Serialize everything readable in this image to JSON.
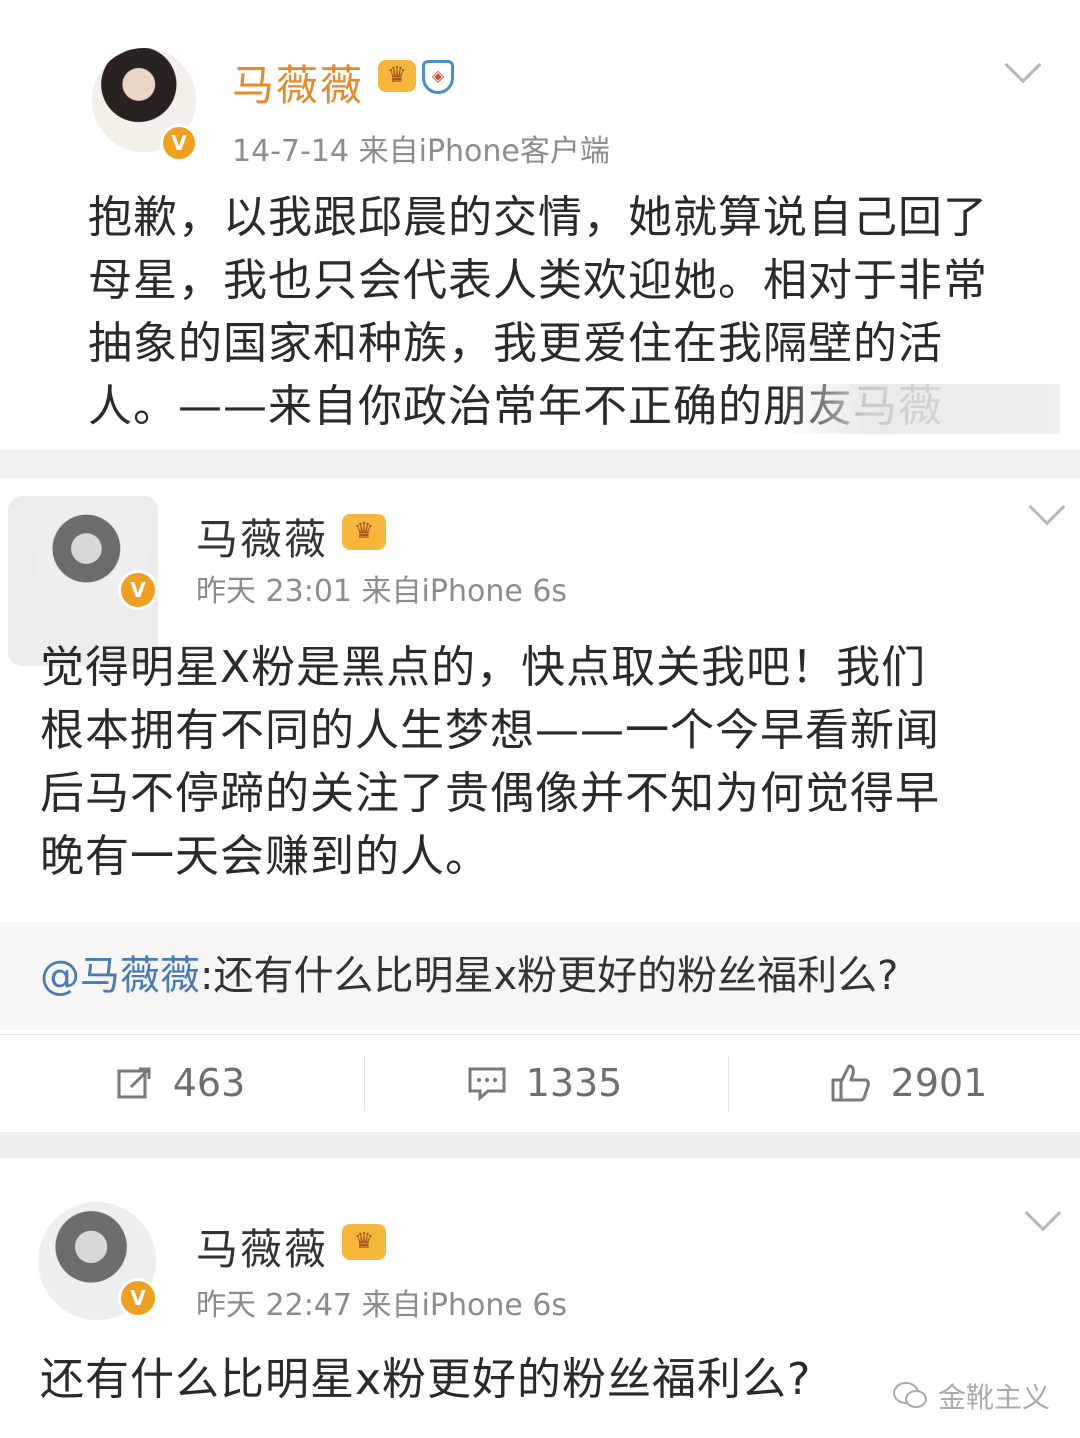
{
  "post1": {
    "username": "马薇薇",
    "meta": "14-7-14  来自iPhone客户端",
    "body_lines": [
      "抱歉，以我跟邱晨的交情，她就算说自己回了",
      "母星，我也只会代表人类欢迎她。相对于非常",
      "抽象的国家和种族，我更爱住在我隔壁的活",
      "人。——来自你政治常年不正确的朋友马薇"
    ],
    "verified_badge": "V"
  },
  "post2": {
    "username": "马薇薇",
    "meta": "昨天 23:01  来自iPhone 6s",
    "body_lines": [
      "觉得明星X粉是黑点的，快点取关我吧！我们",
      "根本拥有不同的人生梦想——一个今早看新闻",
      "后马不停蹄的关注了贵偶像并不知为何觉得早",
      "晚有一天会赚到的人。"
    ],
    "repost_mention": "@马薇薇",
    "repost_text": ":还有什么比明星x粉更好的粉丝福利么?",
    "actions": {
      "repost_count": "463",
      "comment_count": "1335",
      "like_count": "2901"
    },
    "verified_badge": "V"
  },
  "post3": {
    "username": "马薇薇",
    "meta": "昨天 22:47  来自iPhone 6s",
    "body_lines": [
      "还有什么比明星x粉更好的粉丝福利么?"
    ],
    "verified_badge": "V"
  },
  "watermark": "金靴主义",
  "icons": [
    "crown-icon",
    "shield-icon",
    "chevron-down-icon",
    "repost-icon",
    "comment-icon",
    "like-icon",
    "wechat-icon"
  ]
}
